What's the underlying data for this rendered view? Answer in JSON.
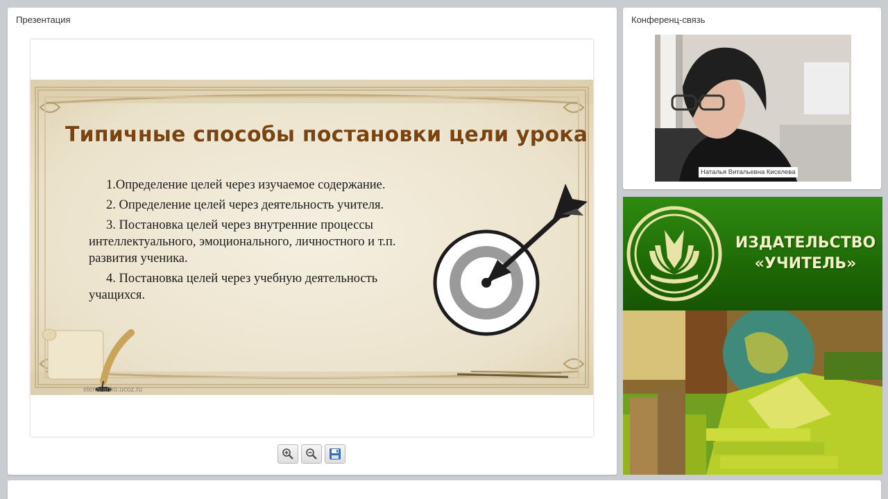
{
  "presentation": {
    "title": "Презентация",
    "slide": {
      "heading": "Типичные способы постановки цели урока",
      "items": [
        "1.Определение целей через изучаемое содержание.",
        "2. Определение целей через деятельность учителя.",
        "3. Постановка целей через внутренние процессы интеллектуального, эмоционального, личностного и т.п. развития ученика.",
        "4. Постановка целей через учебную деятельность учащихся."
      ],
      "site": "elenaranko.ucoz.ru"
    },
    "toolbar": {
      "zoom_in_icon": "zoom-in-icon",
      "zoom_out_icon": "zoom-out-icon",
      "save_icon": "floppy-disk-icon"
    }
  },
  "conference": {
    "title": "Конференц-связь",
    "speaker_name": "Наталья Витальевна Киселева"
  },
  "publisher_banner": {
    "line1": "ИЗДАТЕЛЬСТВО",
    "line2": "«УЧИТЕЛЬ»",
    "brand_color": "#1e6a06",
    "text_color": "#f3efc6"
  }
}
